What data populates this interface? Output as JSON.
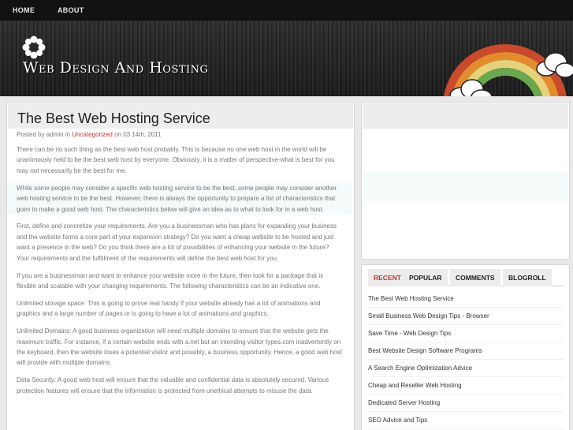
{
  "nav": {
    "items": [
      "HOME",
      "ABOUT"
    ]
  },
  "header": {
    "site_title": "Web Design And Hosting"
  },
  "post": {
    "title": "The Best Web Hosting Service",
    "meta_prefix": "Posted by admin in ",
    "category": "Uncategorized",
    "meta_suffix": " on 03 14th, 2011",
    "paragraphs": [
      "There can be no such thing as the best web host probably. This is because no one web host in the world will be unanimously held to be the best web host by everyone. Obviously, it is a matter of perspective-what is best for you may not necessarily be the best for me.",
      "While some people may consider a specific web hosting service to be the best, some people may consider another web hosting service to be the best. However, there is always the opportunity to prepare a list of characteristics that goes to make a good web host. The characteristics below will give an idea as to what to look for in a web host.",
      "First, define and concretize your requirements. Are you a businessman who has plans for expanding your business and the website forms a core part of your expansion strategy? Do you want a cheap website to be hosted and just want a presence in the web? Do you think there are a lot of possibilities of enhancing your website in the future? Your requirements and the fulfillment of the requirements will define the best web host for you.",
      "If you are a businessman and want to enhance your website more in the future, then look for a package that is flexible and scalable with your changing requirements. The following characteristics can be an indicative one.",
      "Unlimited storage space: This is going to prove real handy if your website already has a lot of animations and graphics and a large number of pages or is going to have a lot of animations and graphics.",
      "Unlimited Domains: A good business organization will need multiple domains to ensure that the website gets the maximum traffic. For instance, if a certain website ends with a.net but an intending visitor types.com inadvertently on the keyboard, then the website loses a potential visitor and possibly, a business opportunity. Hence, a good web host will provide with multiple domains.",
      "Data Security: A good web host will ensure that the valuable and confidential data is absolutely secured. Various protection features will ensure that the information is protected from unethical attempts to misuse the data."
    ]
  },
  "sidebar": {
    "tabs": [
      "RECENT",
      "POPULAR",
      "COMMENTS",
      "BLOGROLL"
    ],
    "recent_posts": [
      "The Best Web Hosting Service",
      "Small Business Web Design Tips - Browser",
      "Save Time - Web Design Tips",
      "Best Website Design Software Programs",
      "A Search Engine Optimization Advice",
      "Cheap and Reseller Web Hosting",
      "Dedicated Server Hosting",
      "SEO Advice and Tips"
    ]
  },
  "colors": {
    "accent": "#c0392b",
    "nav_bg": "#111111",
    "page_bg": "#e9e9e9"
  }
}
